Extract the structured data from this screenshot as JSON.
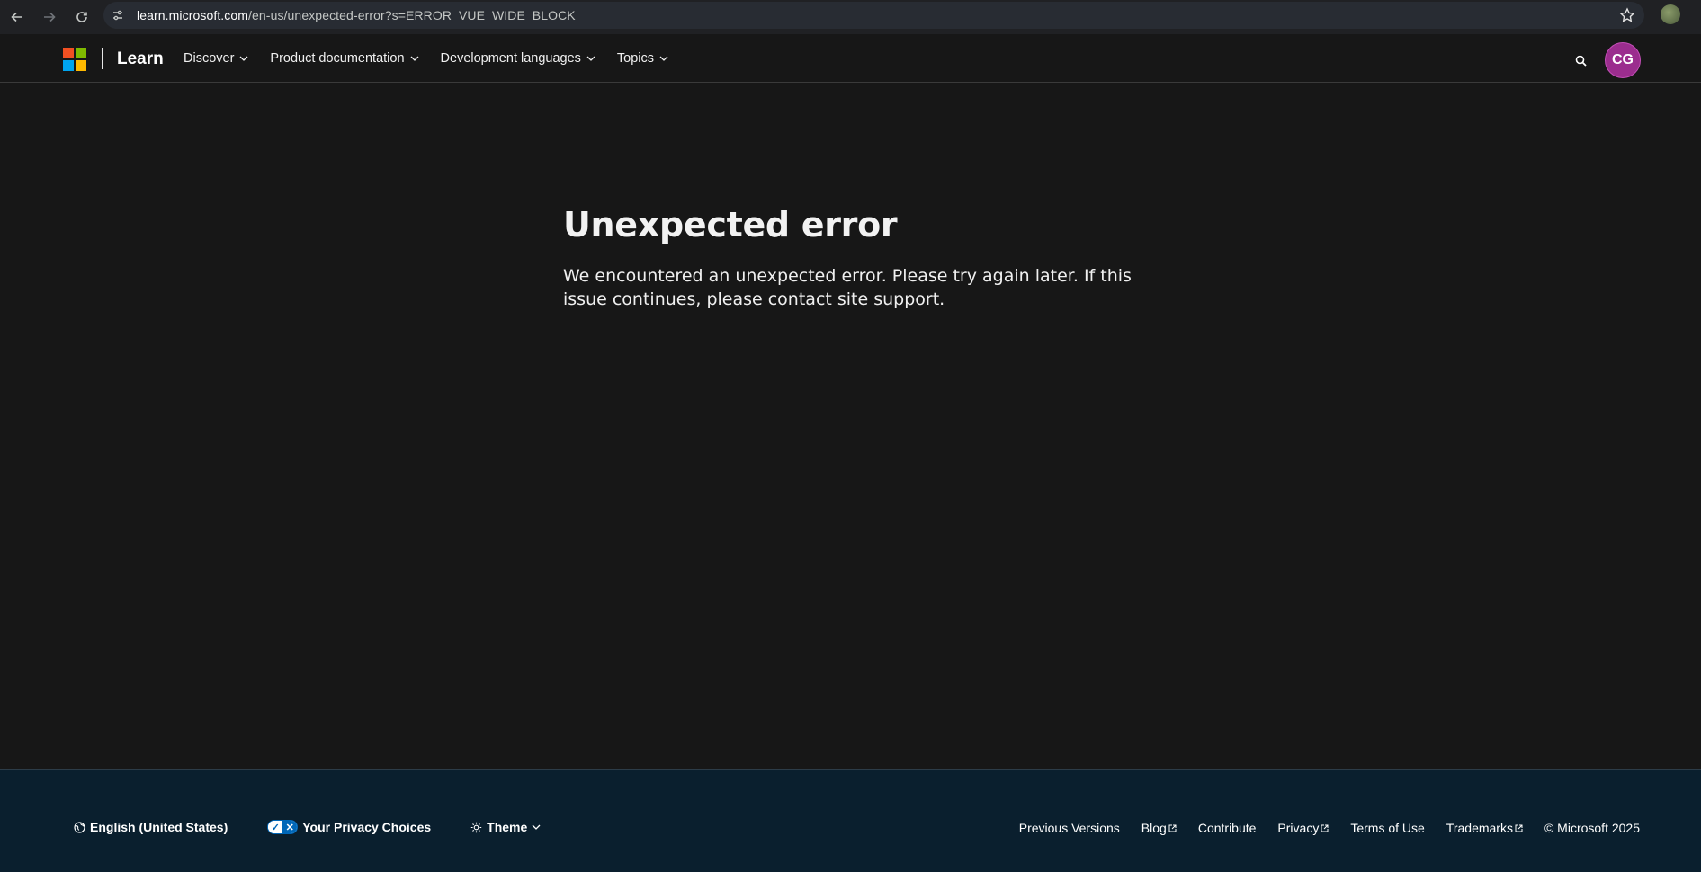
{
  "browser": {
    "url_host": "learn.microsoft.com",
    "url_path": "/en-us/unexpected-error?s=ERROR_VUE_WIDE_BLOCK",
    "icons": [
      "back-icon",
      "forward-icon",
      "reload-icon",
      "site-info-icon",
      "bookmark-star-icon",
      "profile-icon"
    ]
  },
  "header": {
    "brand": "Learn",
    "nav": [
      {
        "label": "Discover"
      },
      {
        "label": "Product documentation"
      },
      {
        "label": "Development languages"
      },
      {
        "label": "Topics"
      }
    ],
    "avatar_initials": "CG",
    "colors": {
      "avatar_bg": "#9b2d8e",
      "logo_red": "#f25022",
      "logo_green": "#7fba00",
      "logo_blue": "#00a4ef",
      "logo_yellow": "#ffb900"
    }
  },
  "main": {
    "title": "Unexpected error",
    "body": "We encountered an unexpected error. Please try again later. If this issue continues, please contact site support."
  },
  "footer": {
    "language": "English (United States)",
    "privacy": "Your Privacy Choices",
    "theme": "Theme",
    "links": [
      {
        "label": "Previous Versions",
        "external": false
      },
      {
        "label": "Blog",
        "external": true
      },
      {
        "label": "Contribute",
        "external": false
      },
      {
        "label": "Privacy",
        "external": true
      },
      {
        "label": "Terms of Use",
        "external": false
      },
      {
        "label": "Trademarks",
        "external": true
      }
    ],
    "copyright": "© Microsoft 2025"
  }
}
